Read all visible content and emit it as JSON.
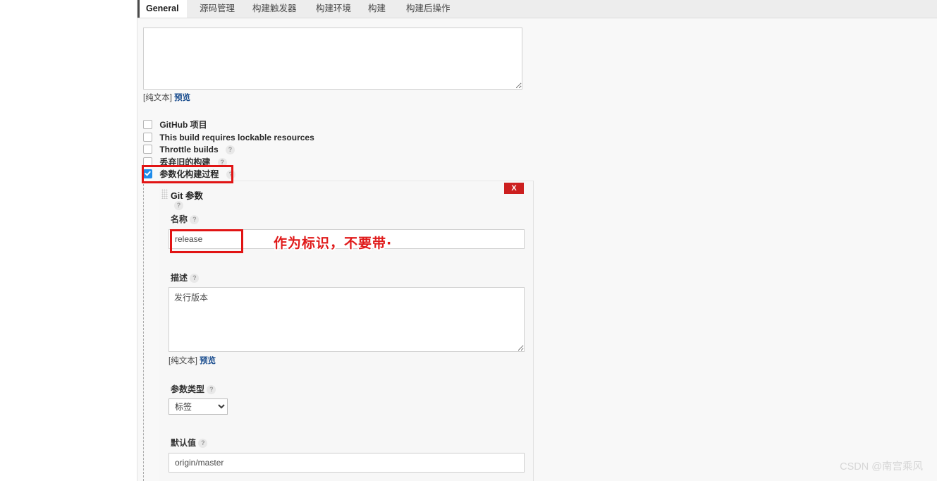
{
  "tabs": [
    {
      "label": "General",
      "active": true
    },
    {
      "label": "源码管理",
      "active": false
    },
    {
      "label": "构建触发器",
      "active": false
    },
    {
      "label": "构建环境",
      "active": false
    },
    {
      "label": "构建",
      "active": false
    },
    {
      "label": "构建后操作",
      "active": false
    }
  ],
  "job_description": {
    "value": "",
    "plain_text_label": "[纯文本]",
    "preview_label": "预览"
  },
  "checkboxes": [
    {
      "label": "GitHub 项目",
      "checked": false,
      "help": ""
    },
    {
      "label": "This build requires lockable resources",
      "checked": false,
      "help": ""
    },
    {
      "label": "Throttle builds",
      "checked": false,
      "help": "?"
    },
    {
      "label": "丢弃旧的构建",
      "checked": false,
      "help": "?"
    },
    {
      "label": "参数化构建过程",
      "checked": true,
      "help": "?"
    }
  ],
  "parameter_panel": {
    "title": "Git 参数",
    "title_help": "?",
    "close_label": "X",
    "name": {
      "label": "名称",
      "help": "?",
      "value": "release"
    },
    "description": {
      "label": "描述",
      "help": "?",
      "value": "发行版本",
      "plain_text_label": "[纯文本]",
      "preview_label": "预览"
    },
    "parameter_type": {
      "label": "参数类型",
      "help": "?",
      "selected": "标签",
      "options": [
        "标签"
      ]
    },
    "default_value": {
      "label": "默认值",
      "help": "?",
      "value": "origin/master"
    }
  },
  "annotations": {
    "note_text": "作为标识，不要带·",
    "highlight_color": "#e11414"
  },
  "watermark": "CSDN @南宫乘风"
}
